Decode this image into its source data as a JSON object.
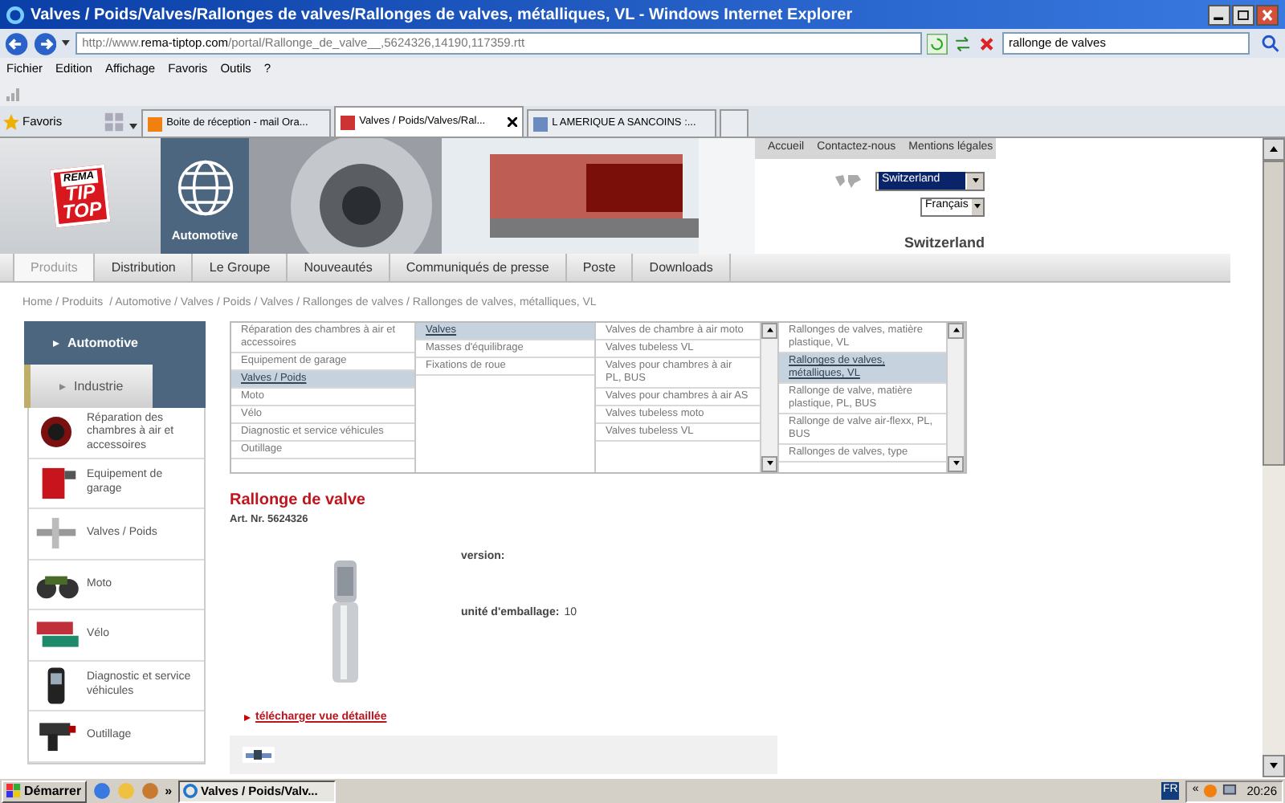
{
  "window": {
    "title": "Valves / Poids/Valves/Rallonges de valves/Rallonges de valves, métalliques, VL - Windows Internet Explorer"
  },
  "address_bar": {
    "url_prefix": "http://www.",
    "url_domain": "rema-tiptop.com",
    "url_rest": "/portal/Rallonge_de_valve__,5624326,14190,117359.rtt"
  },
  "search_field": {
    "value": "rallonge de valves"
  },
  "menu": [
    "Fichier",
    "Edition",
    "Affichage",
    "Favoris",
    "Outils",
    "?"
  ],
  "favorites_label": "Favoris",
  "browser_tabs": [
    {
      "label": "Boite de réception - mail Ora...",
      "selected": false
    },
    {
      "label": "Valves / Poids/Valves/Ral...",
      "selected": true
    },
    {
      "label": "L AMERIQUE A SANCOINS :...",
      "selected": false
    }
  ],
  "site": {
    "logo": [
      "REMA",
      "TIP",
      "TOP"
    ],
    "division": "Automotive",
    "top_links": [
      "Accueil",
      "Contactez-nous",
      "Mentions légales"
    ],
    "country_select": "Switzerland",
    "language_select": "Français",
    "country_heading": "Switzerland",
    "nav": [
      {
        "label": "Produits",
        "selected": true
      },
      {
        "label": "Distribution",
        "selected": false
      },
      {
        "label": "Le Groupe",
        "selected": false
      },
      {
        "label": "Nouveautés",
        "selected": false
      },
      {
        "label": "Communiqués de presse",
        "selected": false
      },
      {
        "label": "Poste",
        "selected": false
      },
      {
        "label": "Downloads",
        "selected": false
      }
    ],
    "breadcrumb": "Home / Produits  / Automotive / Valves / Poids / Valves / Rallonges de valves / Rallonges de valves, métalliques, VL"
  },
  "sidebar": {
    "sections": [
      {
        "label": "Automotive",
        "selected": true
      },
      {
        "label": "Industrie",
        "selected": false
      }
    ],
    "categories": [
      "Réparation des chambres à air et accessoires",
      "Equipement de garage",
      "Valves / Poids",
      "Moto",
      "Vélo",
      "Diagnostic et service véhicules",
      "Outillage"
    ]
  },
  "category_browser": {
    "columns": [
      {
        "scrollable": false,
        "items": [
          {
            "label": "Réparation des chambres à air et accessoires",
            "selected": false
          },
          {
            "label": "Equipement de garage",
            "selected": false
          },
          {
            "label": "Valves / Poids",
            "selected": true
          },
          {
            "label": "Moto",
            "selected": false
          },
          {
            "label": "Vélo",
            "selected": false
          },
          {
            "label": "Diagnostic et service véhicules",
            "selected": false
          },
          {
            "label": "Outillage",
            "selected": false
          }
        ]
      },
      {
        "scrollable": false,
        "items": [
          {
            "label": "Valves",
            "selected": true
          },
          {
            "label": "Masses d'équilibrage",
            "selected": false
          },
          {
            "label": "Fixations de roue",
            "selected": false
          }
        ]
      },
      {
        "scrollable": true,
        "items": [
          {
            "label": "Valves de chambre à air moto",
            "selected": false
          },
          {
            "label": "Valves tubeless VL",
            "selected": false
          },
          {
            "label": "Valves pour chambres à air PL, BUS",
            "selected": false
          },
          {
            "label": "Valves pour chambres à air AS",
            "selected": false
          },
          {
            "label": "Valves tubeless moto",
            "selected": false
          },
          {
            "label": "Valves tubeless VL",
            "selected": false
          }
        ]
      },
      {
        "scrollable": true,
        "items": [
          {
            "label": "Rallonges de valves, matière plastique, VL",
            "selected": false
          },
          {
            "label": "Rallonges de valves, métalliques, VL",
            "selected": true
          },
          {
            "label": "Rallonge de valve, matière plastique, PL, BUS",
            "selected": false
          },
          {
            "label": "Rallonge de valve air-flexx, PL, BUS",
            "selected": false
          },
          {
            "label": "Rallonges de valves, type",
            "selected": false
          }
        ]
      }
    ]
  },
  "product": {
    "title": "Rallonge de valve",
    "article": "Art. Nr. 5624326",
    "version_label": "version:",
    "packaging_label": "unité d'emballage:",
    "packaging_value": "10",
    "download_link": "télécharger vue détaillée"
  },
  "taskbar": {
    "start": "Démarrer",
    "chevron": "»",
    "windows": [
      {
        "label": "Valves / Poids/Valv...",
        "selected": true
      }
    ],
    "language": "FR",
    "tray_chevron": "«",
    "clock": "20:26"
  }
}
